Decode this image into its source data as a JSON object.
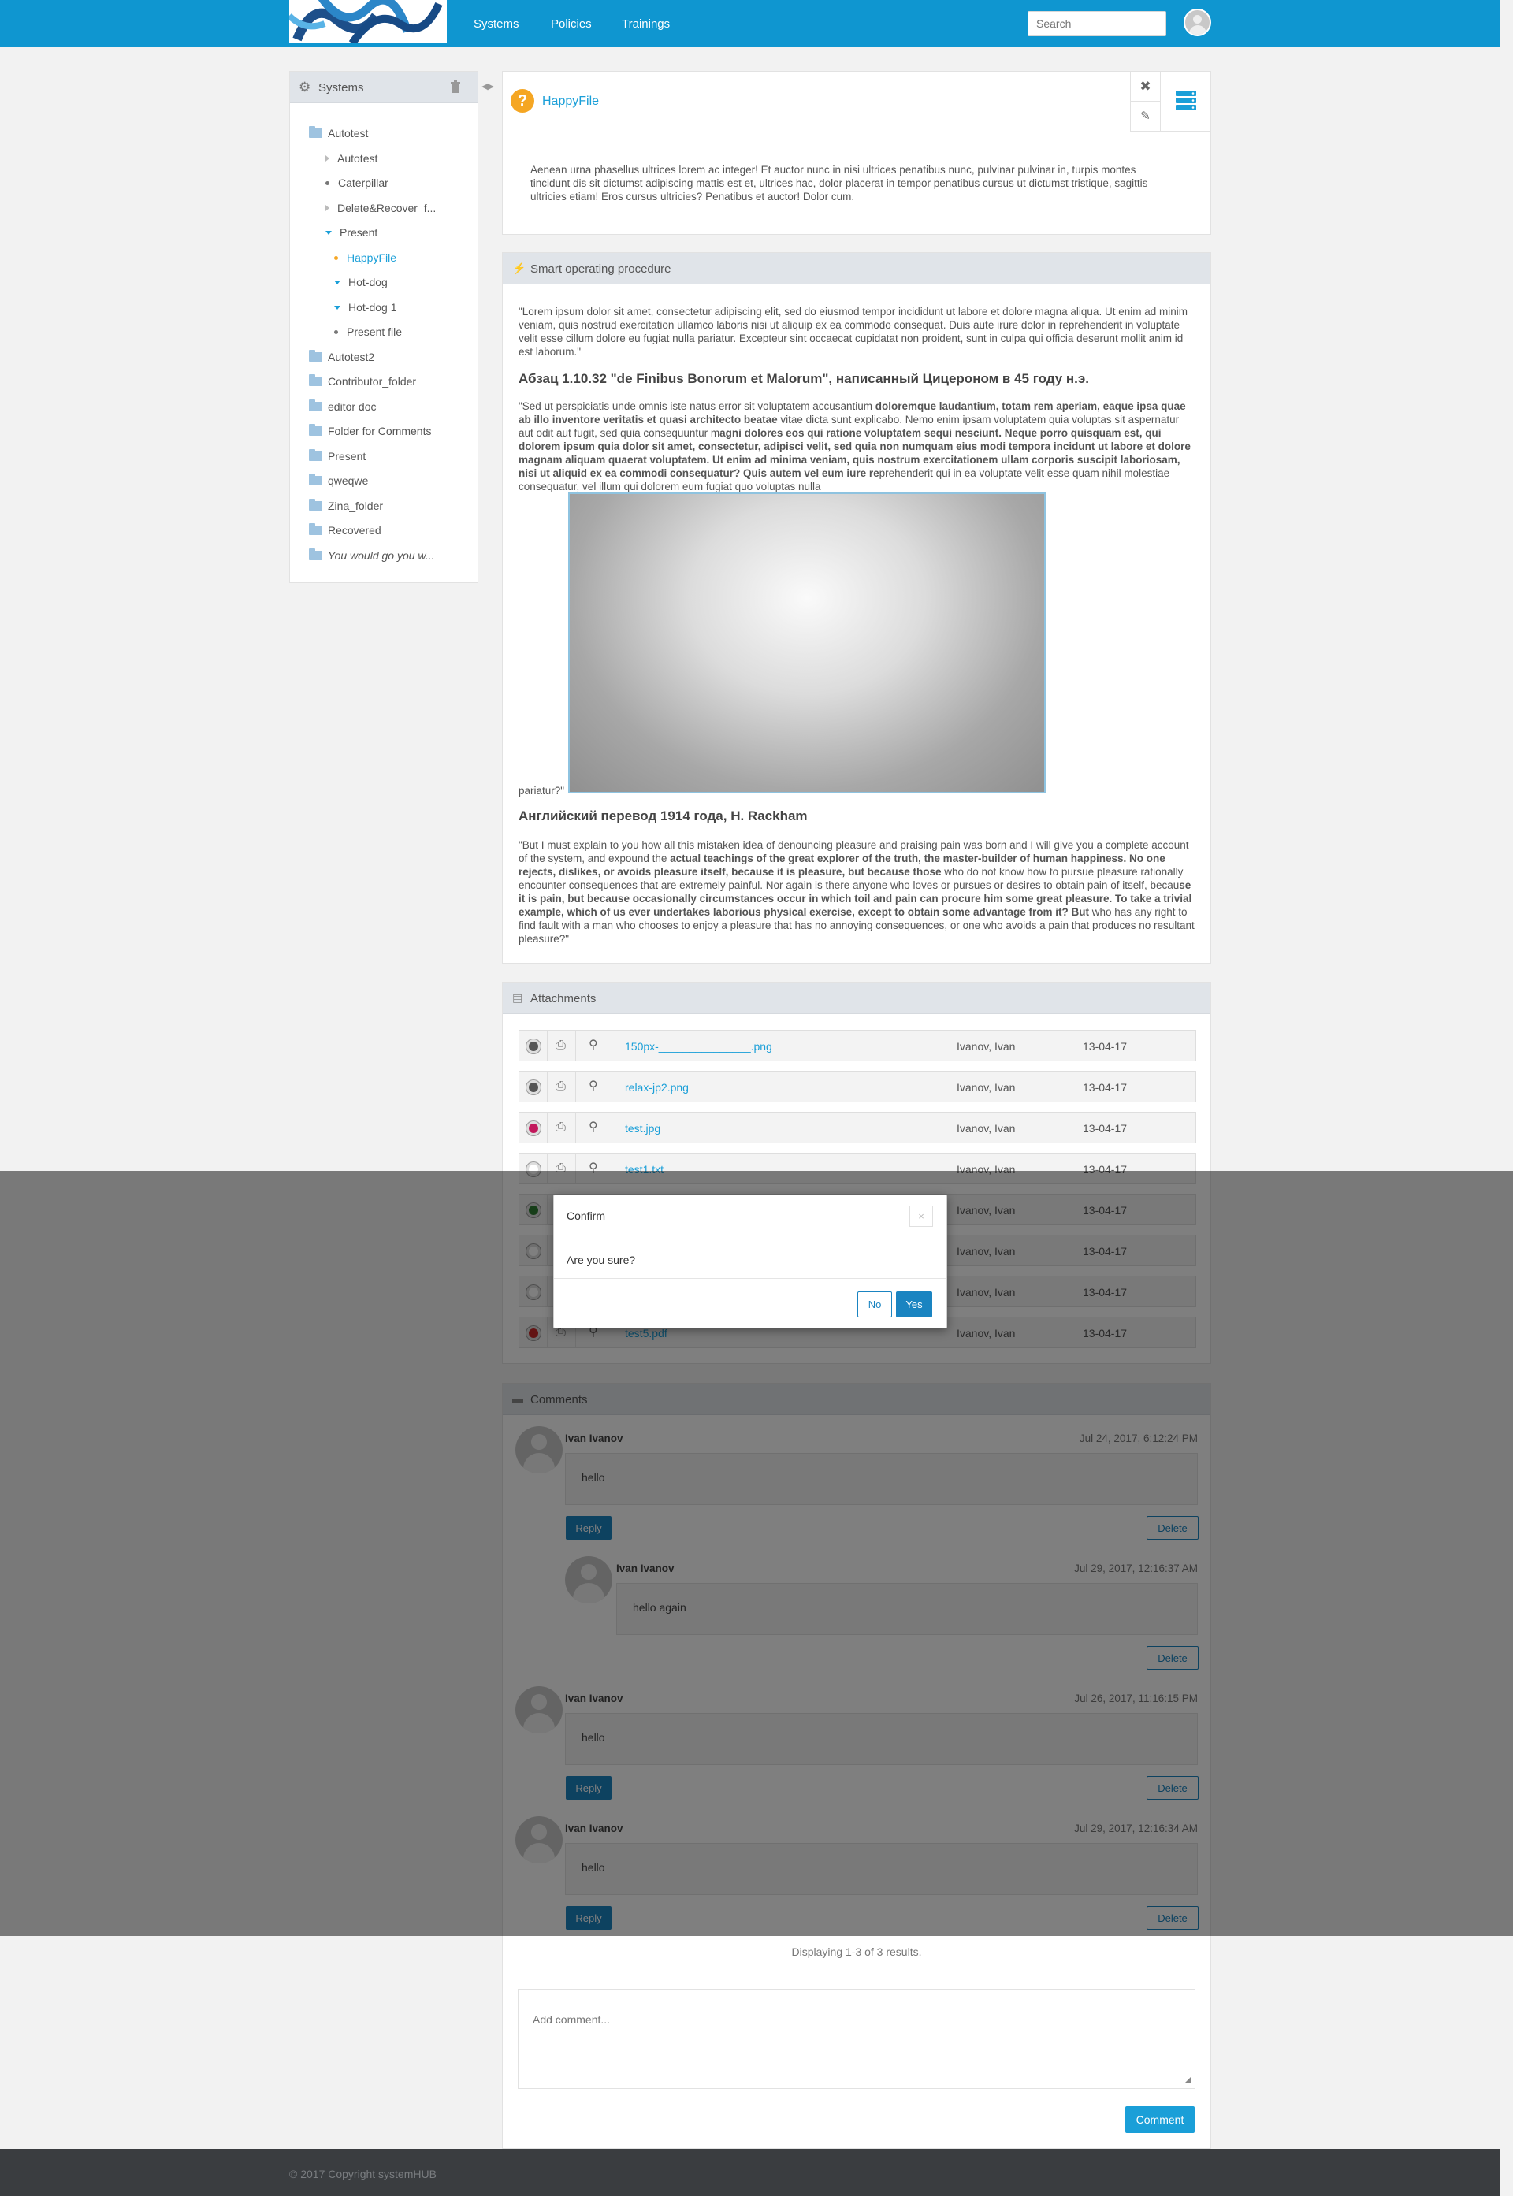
{
  "header": {
    "nav": [
      "Systems",
      "Policies",
      "Trainings"
    ],
    "search_placeholder": "Search"
  },
  "sidebar": {
    "title": "Systems",
    "items": [
      {
        "label": "Autotest"
      },
      {
        "label": "Autotest"
      },
      {
        "label": "Caterpillar"
      },
      {
        "label": "Delete&Recover_f..."
      },
      {
        "label": "Present"
      },
      {
        "label": "HappyFile"
      },
      {
        "label": "Hot-dog"
      },
      {
        "label": "Hot-dog 1"
      },
      {
        "label": "Present file"
      },
      {
        "label": "Autotest2"
      },
      {
        "label": "Contributor_folder"
      },
      {
        "label": "editor doc"
      },
      {
        "label": "Folder for Comments"
      },
      {
        "label": "Present"
      },
      {
        "label": "qweqwe"
      },
      {
        "label": "Zina_folder"
      },
      {
        "label": "Recovered"
      },
      {
        "label": "You would go you w..."
      }
    ]
  },
  "file": {
    "title": "HappyFile",
    "description": "Aenean urna phasellus ultrices lorem ac integer! Et auctor nunc in nisi ultrices penatibus nunc, pulvinar pulvinar in, turpis montes tincidunt dis sit dictumst adipiscing mattis est et, ultrices hac, dolor placerat in tempor penatibus cursus ut dictumst tristique, sagittis ultricies etiam! Eros cursus ultricies? Penatibus et auctor! Dolor cum."
  },
  "procedure": {
    "title": "Smart operating procedure",
    "para1": "\"Lorem ipsum dolor sit amet, consectetur adipiscing elit, sed do eiusmod tempor incididunt ut labore et dolore magna aliqua. Ut enim ad minim veniam, quis nostrud exercitation ullamco laboris nisi ut aliquip ex ea commodo consequat. Duis aute irure dolor in reprehenderit in voluptate velit esse cillum dolore eu fugiat nulla pariatur. Excepteur sint occaecat cupidatat non proident, sunt in culpa qui officia deserunt mollit anim id est laborum.\"",
    "heading1": "Абзац 1.10.32 \"de Finibus Bonorum et Malorum\", написанный Цицероном в 45 году н.э.",
    "para2_a": "\"Sed ut perspiciatis unde omnis iste natus error sit voluptatem accusantium ",
    "para2_b": "doloremque laudantium, totam rem aperiam, eaque ipsa quae ab illo inventore veritatis et quasi architecto beatae",
    "para2_c": " vitae dicta sunt explicabo. Nemo enim ipsam voluptatem quia voluptas sit aspernatur aut odit aut fugit, sed quia consequuntur m",
    "para2_d": "agni dolores eos qui ratione voluptatem sequi nesciunt. Neque porro quisquam est, qui dolorem ipsum quia dolor sit amet, consectetur, adipisci velit, sed quia non numquam eius modi tempora incidunt ut labore et dolore magnam aliquam quaerat voluptatem. Ut enim ad minima veniam, quis nostrum exercitationem ullam corporis suscipit laboriosam, nisi ut aliquid ex ea commodi consequatur? Quis autem vel eum iure re",
    "para2_e": "prehenderit qui in ea voluptate velit esse quam nihil molestiae consequatur, vel illum qui dolorem eum fugiat quo voluptas nulla",
    "para2_end": "pariatur?\"",
    "heading2": "Английский перевод 1914 года, H. Rackham",
    "para3_a": "\"But I must explain to you how all this mistaken idea of denouncing pleasure and praising pain was born and I will give you a complete account of the system, and expound the ",
    "para3_b": "actual teachings of the great explorer of the truth, the master-builder of human happiness. No one rejects, dislikes, or avoids pleasure itself, because it is pleasure, but because those",
    "para3_c": " who do not know how to pursue pleasure rationally encounter consequences that are extremely painful. Nor again is there anyone who loves or pursues or desires to obtain pain of itself, becau",
    "para3_d": "se it is pain, but because occasionally circumstances occur in which toil and pain can procure him some great pleasure. To take a trivial example, which of us ever undertakes laborious physical exercise, except to obtain some advantage from it? But",
    "para3_e": " who has any right to find fault with a man who chooses to enjoy a pleasure that has no annoying consequences, or one who avoids a pain that produces no resultant pleasure?\""
  },
  "attachments": {
    "title": "Attachments",
    "rows": [
      {
        "name": "150px-_______________.png",
        "user": "Ivanov, Ivan",
        "date": "13-04-17",
        "icon_color": "#555555"
      },
      {
        "name": "relax-jp2.png",
        "user": "Ivanov, Ivan",
        "date": "13-04-17",
        "icon_color": "#555555"
      },
      {
        "name": "test.jpg",
        "user": "Ivanov, Ivan",
        "date": "13-04-17",
        "icon_color": "#c2185b"
      },
      {
        "name": "test1.txt",
        "user": "Ivanov, Ivan",
        "date": "13-04-17",
        "icon_color": "#ffffff"
      },
      {
        "name": "",
        "user": "Ivanov, Ivan",
        "date": "13-04-17",
        "icon_color": "#2e7d32"
      },
      {
        "name": "",
        "user": "Ivanov, Ivan",
        "date": "13-04-17",
        "icon_color": "#ffffff"
      },
      {
        "name": "",
        "user": "Ivanov, Ivan",
        "date": "13-04-17",
        "icon_color": "#ffffff"
      },
      {
        "name": "test5.pdf",
        "user": "Ivanov, Ivan",
        "date": "13-04-17",
        "icon_color": "#c62828"
      }
    ]
  },
  "comments": {
    "title": "Comments",
    "items": [
      {
        "author": "Ivan Ivanov",
        "time": "Jul 24, 2017, 6:12:24 PM",
        "text": "hello",
        "reply": "Reply",
        "delete": "Delete"
      },
      {
        "author": "Ivan Ivanov",
        "time": "Jul 29, 2017, 12:16:37 AM",
        "text": "hello again",
        "delete": "Delete"
      },
      {
        "author": "Ivan Ivanov",
        "time": "Jul 26, 2017, 11:16:15 PM",
        "text": "hello",
        "reply": "Reply",
        "delete": "Delete"
      },
      {
        "author": "Ivan Ivanov",
        "time": "Jul 29, 2017, 12:16:34 AM",
        "text": "hello",
        "reply": "Reply",
        "delete": "Delete"
      }
    ],
    "pager": "Displaying 1-3 of 3 results.",
    "add_placeholder": "Add comment...",
    "submit": "Comment"
  },
  "footer": {
    "copyright": "© 2017 Copyright systemHUB"
  },
  "modal": {
    "title": "Confirm",
    "close": "×",
    "body": "Are you sure?",
    "no": "No",
    "yes": "Yes"
  }
}
